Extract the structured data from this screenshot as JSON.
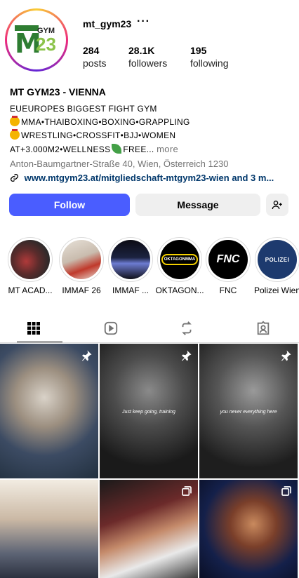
{
  "profile": {
    "username": "mt_gym23",
    "more_icon": "more-horizontal-icon",
    "stats": {
      "posts_count": "284",
      "posts_label": "posts",
      "followers_count": "28.1K",
      "followers_label": "followers",
      "following_count": "195",
      "following_label": "following"
    },
    "logo": {
      "m": "M",
      "t": "T",
      "gym": "GYM",
      "num": "23"
    }
  },
  "bio": {
    "name": "MT GYM23 - VIENNA",
    "line1": "EUEUROPES BIGGEST FIGHT GYM",
    "line2": "MMA•THAIBOXING•BOXING•GRAPPLING",
    "line3": "WRESTLING•CROSSFIT•BJJ•WOMEN",
    "line4": "AT+3.000M2•WELLNESS",
    "line4_end": "FREE...",
    "more": "more",
    "address": "Anton-Baumgartner-Straße 40, Wien, Österreich 1230",
    "link": "www.mtgym23.at/mitgliedschaft-mtgym23-wien and 3 m..."
  },
  "actions": {
    "follow": "Follow",
    "message": "Message",
    "add_user_icon": "add-user-icon"
  },
  "highlights": [
    {
      "label": "MT ACAD..."
    },
    {
      "label": "IMMAF 26"
    },
    {
      "label": "IMMAF ..."
    },
    {
      "label": "OKTAGON..."
    },
    {
      "label": "FNC"
    },
    {
      "label": "Polizei Wien"
    }
  ],
  "highlight_art": {
    "oktagon": "OKTAGONMMA",
    "fnc": "FNC",
    "polizei": "POLIZEI"
  },
  "tabs": [
    "posts-grid-icon",
    "reels-icon",
    "tagged-repost-icon",
    "tagged-user-icon"
  ],
  "posts": [
    {
      "caption": "",
      "pinned": true
    },
    {
      "caption": "Just keep going, training",
      "pinned": true
    },
    {
      "caption": "you never everything here",
      "pinned": true
    },
    {
      "caption": "",
      "pinned": false
    },
    {
      "caption": "",
      "pinned": false
    },
    {
      "caption": "",
      "pinned": false
    }
  ],
  "colors": {
    "follow_button": "#4a5dff",
    "link": "#00376b",
    "secondary_text": "#737373"
  }
}
